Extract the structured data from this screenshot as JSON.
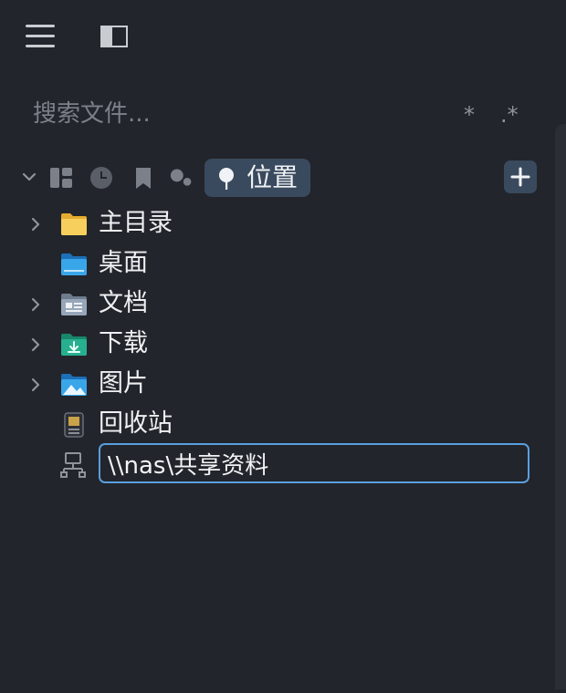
{
  "search": {
    "placeholder": "搜索文件...",
    "glob_toggle": "*",
    "regex_toggle": ".*"
  },
  "category_bar": {
    "active_label": "位置",
    "icons": [
      "grid-icon",
      "clock-icon",
      "bookmark-icon",
      "tag-icon",
      "pin-icon",
      "plus-icon"
    ]
  },
  "places": {
    "items": [
      {
        "label": "主目录",
        "icon": "home-folder-icon",
        "expandable": true
      },
      {
        "label": "桌面",
        "icon": "desktop-folder-icon",
        "expandable": false
      },
      {
        "label": "文档",
        "icon": "documents-folder-icon",
        "expandable": true
      },
      {
        "label": "下载",
        "icon": "downloads-folder-icon",
        "expandable": true
      },
      {
        "label": "图片",
        "icon": "pictures-folder-icon",
        "expandable": true
      },
      {
        "label": "回收站",
        "icon": "trash-icon",
        "expandable": false
      }
    ],
    "new_entry": {
      "icon": "network-icon",
      "value": "\\\\nas\\共享资料"
    }
  },
  "colors": {
    "background": "#22252b",
    "accent": "#5a9fdf",
    "pill": "#3a4a5e",
    "folder_yellow": "#f3c64d",
    "folder_blue": "#3a9ee4"
  }
}
